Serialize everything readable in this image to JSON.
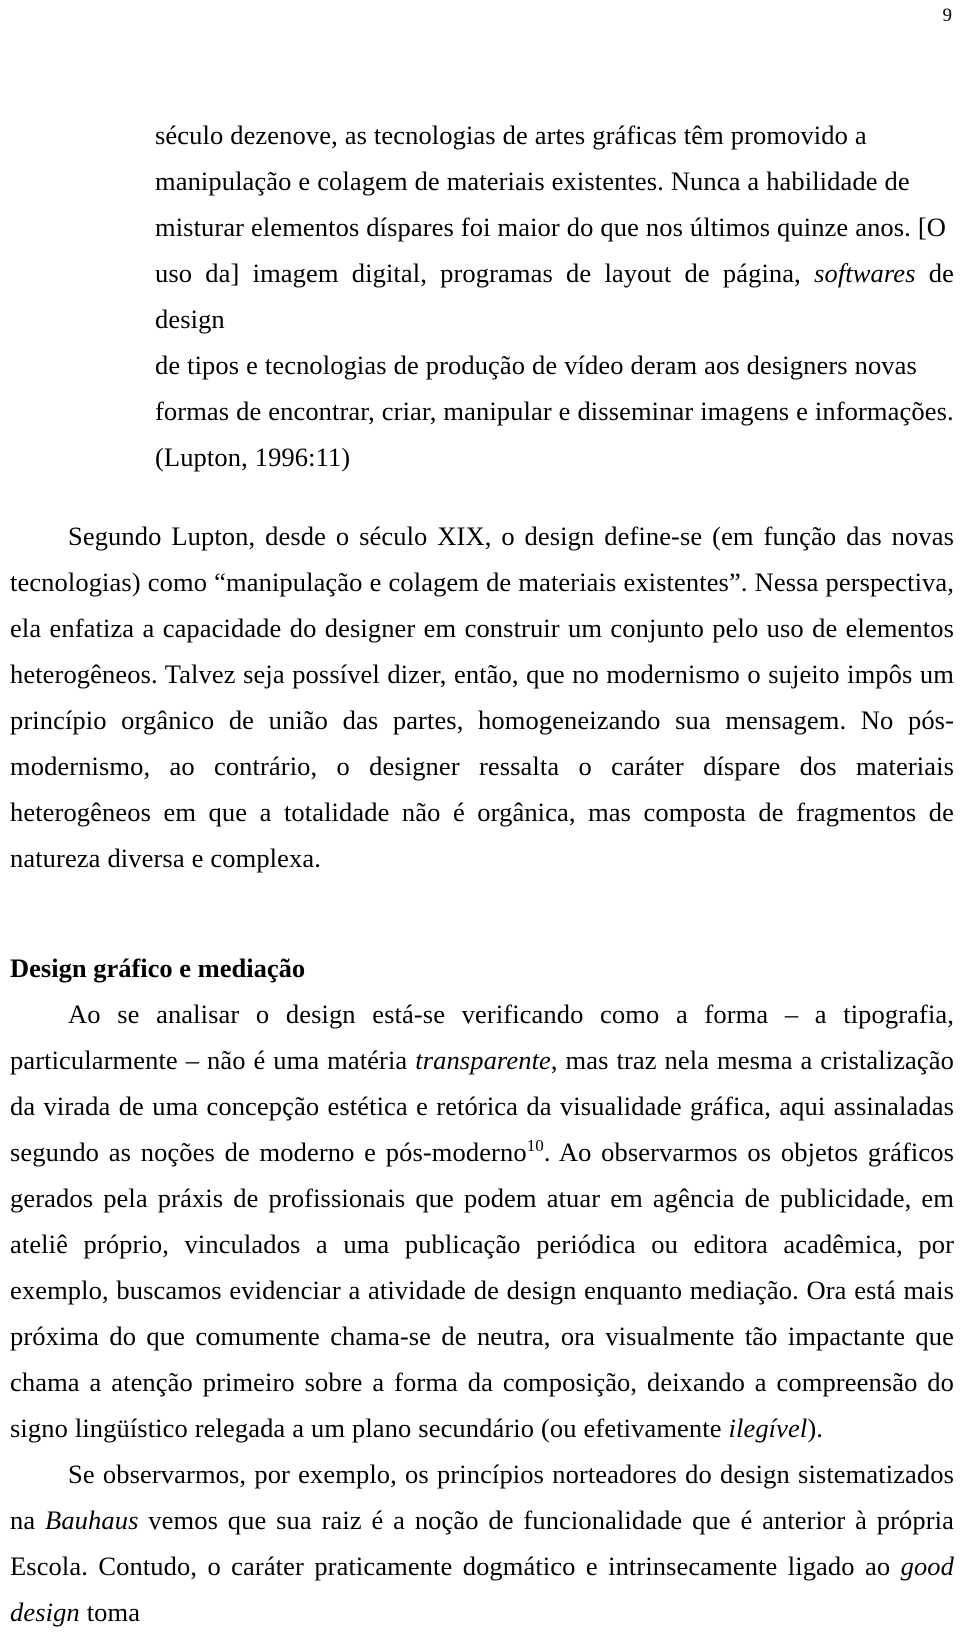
{
  "document": {
    "page_number": "9",
    "language": "pt-BR"
  },
  "blockquote": {
    "line1": "século dezenove, as tecnologias de artes gráficas têm promovido a",
    "line2": "manipulação e colagem de materiais existentes. Nunca a habilidade de",
    "line3_a": "misturar elementos díspares foi maior do que nos últimos quinze anos. [O",
    "line4_a": "uso da] imagem digital, programas de layout de página, ",
    "line4_italic": "softwares",
    "line4_b": " de design",
    "line5": "de tipos e tecnologias de produção de vídeo deram aos designers novas",
    "line6": "formas de encontrar, criar, manipular e disseminar imagens e informações.",
    "citation": "(Lupton, 1996:11)"
  },
  "paragraph_1": {
    "text": "Segundo Lupton, desde o século XIX, o design define-se (em função das novas tecnologias) como “manipulação e colagem de materiais existentes”. Nessa perspectiva, ela enfatiza a capacidade do designer em construir um conjunto pelo uso de elementos heterogêneos. Talvez seja possível dizer, então, que no modernismo o sujeito impôs um princípio orgânico de união das partes, homogeneizando sua mensagem. No pós-modernismo, ao contrário, o designer ressalta o caráter díspare dos materiais heterogêneos em que a totalidade não é orgânica, mas composta de fragmentos de natureza diversa e complexa."
  },
  "section_heading": {
    "text": "Design gráfico e mediação"
  },
  "paragraph_2": {
    "part_a": "Ao se analisar o design está-se verificando como a forma – a tipografia, particularmente – não é uma matéria ",
    "italic_1": "transparente",
    "part_b": ", mas traz nela mesma a cristalização da virada de uma concepção estética e retórica da visualidade gráfica, aqui assinaladas segundo as noções de moderno e pós-moderno",
    "footnote_marker": "10",
    "part_c": ". Ao observarmos os objetos gráficos gerados pela práxis de profissionais que podem atuar em agência de publicidade, em ateliê próprio, vinculados a uma publicação periódica ou editora acadêmica, por exemplo, buscamos evidenciar a atividade de design enquanto mediação. Ora está mais próxima do que comumente chama-se de neutra, ora visualmente tão impactante que chama a atenção primeiro sobre a forma da composição, deixando a compreensão do signo lingüístico relegada a um plano secundário (ou efetivamente ",
    "italic_2": "ilegível",
    "part_d": ")."
  },
  "paragraph_3": {
    "part_a": "Se observarmos, por exemplo, os princípios norteadores do design sistematizados na ",
    "italic_1": "Bauhaus",
    "part_b": " vemos que sua raiz é a noção de funcionalidade que é anterior à própria Escola. Contudo, o caráter praticamente dogmático e intrinsecamente ligado ao ",
    "italic_2": "good design",
    "part_c": " toma"
  }
}
